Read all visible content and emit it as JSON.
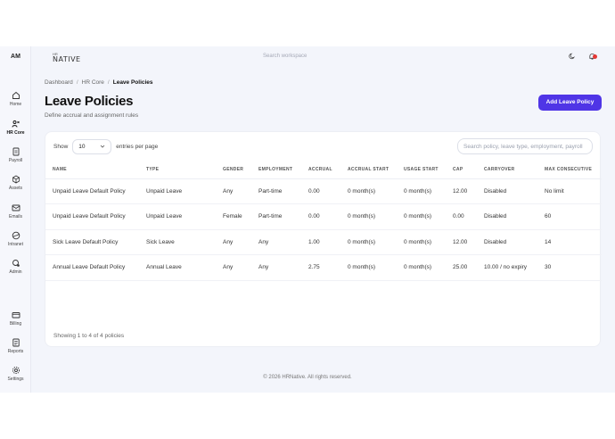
{
  "user": {
    "initials": "AM"
  },
  "sidebar": {
    "items": [
      {
        "label": "Home",
        "icon": "home-icon"
      },
      {
        "label": "HR Core",
        "icon": "people-icon",
        "active": true
      },
      {
        "label": "Payroll",
        "icon": "document-icon"
      },
      {
        "label": "Assets",
        "icon": "box-icon"
      },
      {
        "label": "Emails",
        "icon": "mail-icon"
      },
      {
        "label": "Intranet",
        "icon": "globe-icon"
      },
      {
        "label": "Admin",
        "icon": "admin-icon"
      },
      {
        "label": "Billing",
        "icon": "card-icon"
      },
      {
        "label": "Reports",
        "icon": "report-icon"
      },
      {
        "label": "Settings",
        "icon": "gear-icon"
      }
    ]
  },
  "brand": {
    "small": "HR",
    "name": "NATIVE"
  },
  "topbar": {
    "search_placeholder": "Search workspace"
  },
  "breadcrumb": {
    "item1": "Dashboard",
    "item2": "HR Core",
    "current": "Leave Policies",
    "separator": "/"
  },
  "page": {
    "title": "Leave Policies",
    "subtitle": "Define accrual and assignment rules",
    "add_button": "Add Leave Policy"
  },
  "table_controls": {
    "show_label": "Show",
    "page_size": "10",
    "entries_label": "entries per page",
    "search_placeholder": "Search policy, leave type, employment, payroll"
  },
  "table": {
    "columns": [
      "NAME",
      "TYPE",
      "GENDER",
      "EMPLOYMENT",
      "ACCRUAL",
      "ACCRUAL START",
      "USAGE START",
      "CAP",
      "CARRYOVER",
      "MAX CONSECUTIVE"
    ],
    "rows": [
      [
        "Unpaid Leave Default Policy",
        "Unpaid Leave",
        "Any",
        "Part-time",
        "0.00",
        "0 month(s)",
        "0 month(s)",
        "12.00",
        "Disabled",
        "No limit"
      ],
      [
        "Unpaid Leave Default Policy",
        "Unpaid Leave",
        "Female",
        "Part-time",
        "0.00",
        "0 month(s)",
        "0 month(s)",
        "0.00",
        "Disabled",
        "60"
      ],
      [
        "Sick Leave Default Policy",
        "Sick Leave",
        "Any",
        "Any",
        "1.00",
        "0 month(s)",
        "0 month(s)",
        "12.00",
        "Disabled",
        "14"
      ],
      [
        "Annual Leave Default Policy",
        "Annual Leave",
        "Any",
        "Any",
        "2.75",
        "0 month(s)",
        "0 month(s)",
        "25.00",
        "10.00 / no expiry",
        "30"
      ]
    ],
    "footer": "Showing 1 to 4 of 4 policies"
  },
  "footer": {
    "copyright": "© 2026 HRNative. All rights reserved."
  },
  "colors": {
    "accent": "#4f35e6",
    "notification": "#e53935",
    "background": "#f3f5fb"
  }
}
